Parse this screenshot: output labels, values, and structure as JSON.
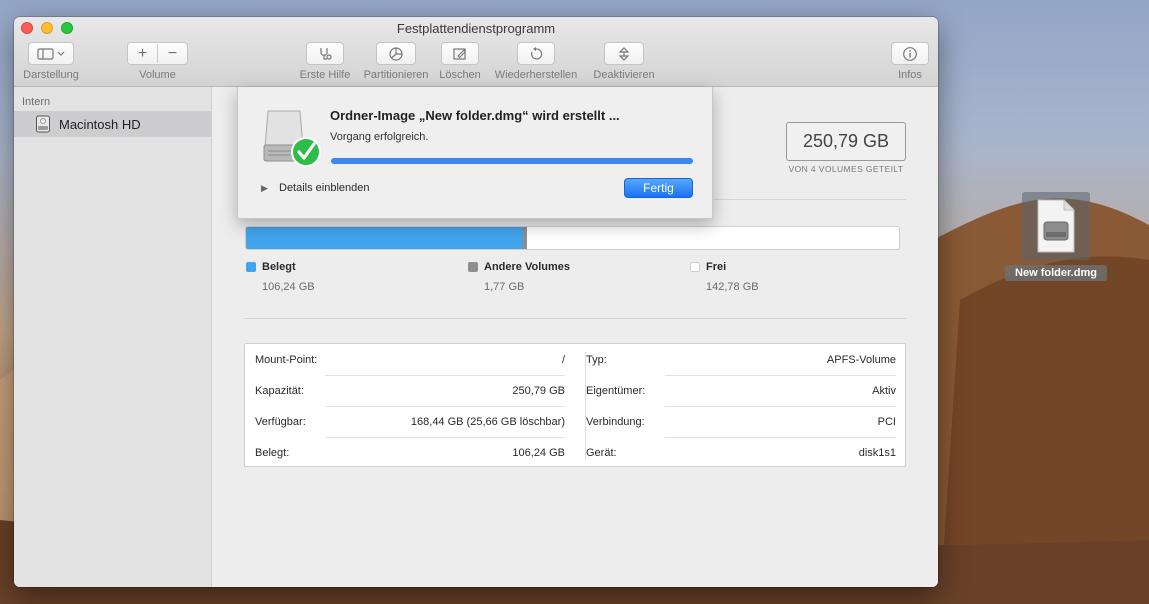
{
  "window": {
    "title": "Festplattendienstprogramm"
  },
  "toolbar": {
    "darstellung": "Darstellung",
    "volume": "Volume",
    "plus": "+",
    "minus": "−",
    "erste_hilfe": "Erste Hilfe",
    "partitionieren": "Partitionieren",
    "loeschen": "Löschen",
    "wiederherstellen": "Wiederherstellen",
    "deaktivieren": "Deaktivieren",
    "infos": "Infos"
  },
  "sidebar": {
    "section": "Intern",
    "items": [
      {
        "label": "Macintosh HD",
        "icon": "hard-disk-icon"
      }
    ]
  },
  "capacity": {
    "value": "250,79 GB",
    "subtitle": "VON 4 VOLUMES GETEILT"
  },
  "usage": {
    "used_fraction": 0.4236,
    "other_fraction": 0.0071,
    "colors": {
      "used": "#41a5ee",
      "other": "#8e8e8e",
      "free": "#ffffff"
    },
    "legend": [
      {
        "label": "Belegt",
        "value": "106,24 GB"
      },
      {
        "label": "Andere Volumes",
        "value": "1,77 GB"
      },
      {
        "label": "Frei",
        "value": "142,78 GB"
      }
    ]
  },
  "info": {
    "left": [
      {
        "key": "Mount-Point:",
        "value": "/"
      },
      {
        "key": "Kapazität:",
        "value": "250,79 GB"
      },
      {
        "key": "Verfügbar:",
        "value": "168,44 GB (25,66 GB löschbar)"
      },
      {
        "key": "Belegt:",
        "value": "106,24 GB"
      }
    ],
    "right": [
      {
        "key": "Typ:",
        "value": "APFS-Volume"
      },
      {
        "key": "Eigentümer:",
        "value": "Aktiv"
      },
      {
        "key": "Verbindung:",
        "value": "PCI"
      },
      {
        "key": "Gerät:",
        "value": "disk1s1"
      }
    ]
  },
  "sheet": {
    "title": "Ordner-Image „New folder.dmg“ wird erstellt ...",
    "status": "Vorgang erfolgreich.",
    "progress": 1.0,
    "details_label": "Details einblenden",
    "done_label": "Fertig"
  },
  "desktop": {
    "file_label": "New folder.dmg"
  }
}
